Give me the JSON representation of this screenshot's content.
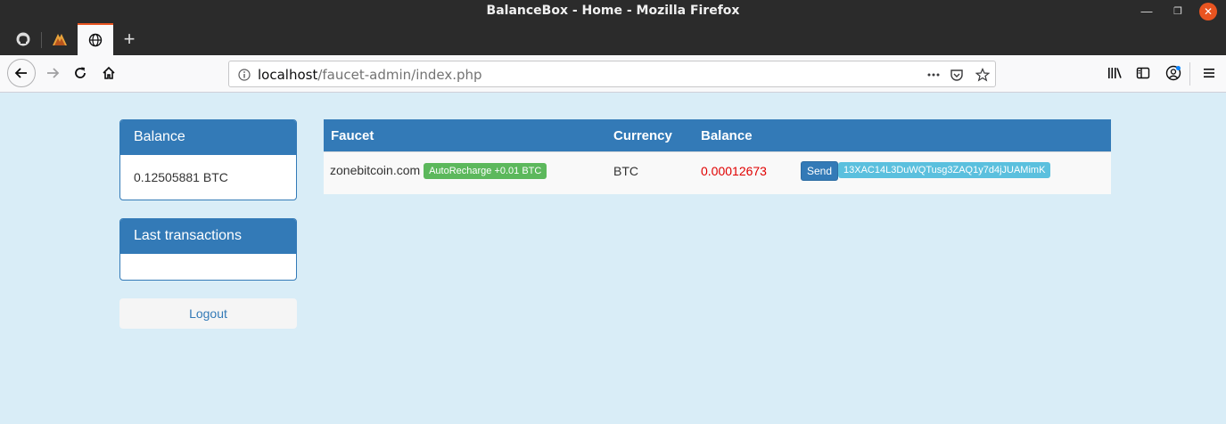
{
  "window": {
    "title": "BalanceBox - Home - Mozilla Firefox"
  },
  "browser": {
    "url_host": "localhost",
    "url_path": "/faucet-admin/index.php"
  },
  "sidebar": {
    "balance_heading": "Balance",
    "balance_value": "0.12505881 BTC",
    "transactions_heading": "Last transactions",
    "logout_label": "Logout"
  },
  "table": {
    "headers": {
      "faucet": "Faucet",
      "currency": "Currency",
      "balance": "Balance"
    },
    "rows": [
      {
        "faucet": "zonebitcoin.com",
        "badge": "AutoRecharge +0.01 BTC",
        "currency": "BTC",
        "balance": "0.00012673",
        "send_label": "Send",
        "address": "13XAC14L3DuWQTusg3ZAQ1y7d4jJUAMimK"
      }
    ]
  },
  "colors": {
    "primary": "#337ab7",
    "success": "#5cb85c",
    "info": "#5bc0de",
    "balance_red": "#e00000",
    "page_bg": "#d9edf7"
  }
}
